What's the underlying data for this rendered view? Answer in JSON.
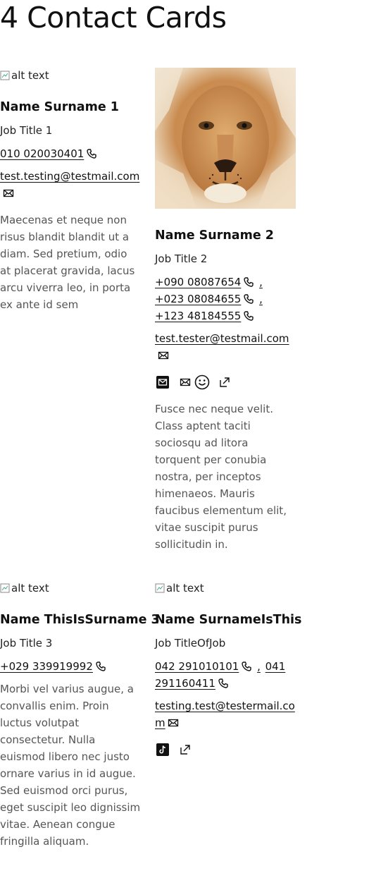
{
  "page": {
    "title": "4 Contact Cards"
  },
  "cards": [
    {
      "image_alt": "alt text",
      "name": "Name Surname 1",
      "job_title": "Job Title 1",
      "phones": [
        "010 020030401"
      ],
      "email": "test.testing@testmail.com",
      "description": "Maecenas et neque non risus blandit blandit ut a diam. Sed pretium, odio at placerat gravida, lacus arcu viverra leo, in porta ex ante id sem"
    },
    {
      "image_alt": "lion photo",
      "name": "Name Surname 2",
      "job_title": "Job Title 2",
      "phones": [
        "+090 08087654",
        "+023 08084655",
        "+123 48184555"
      ],
      "separator": ",",
      "email": "test.tester@testmail.com",
      "social_icons": [
        "mail-square-icon",
        "mail-icon",
        "smiley-icon",
        "external-link-icon"
      ],
      "description": "Fusce nec neque velit. Class aptent taciti sociosqu ad litora torquent per conubia nostra, per inceptos himenaeos. Mauris faucibus elementum elit, vitae suscipit purus sollicitudin in."
    },
    {
      "image_alt": "alt text",
      "name": "Name ThisIsSurname 3",
      "job_title": "Job Title 3",
      "phones": [
        "+029 339919992"
      ],
      "description": "Morbi vel varius augue, a convallis enim. Proin luctus volutpat consectetur. Nulla euismod libero nec justo ornare varius in id augue. Sed euismod orci purus, eget suscipit leo dignissim vitae. Aenean congue fringilla aliquam."
    },
    {
      "image_alt": "alt text",
      "name": "Name SurnameIsThis",
      "job_title": "Job TitleOfJob",
      "phones": [
        "042 291010101",
        "041 291160411"
      ],
      "separator": ",",
      "email": "testing.test@testermail.com",
      "social_icons": [
        "tiktok-icon",
        "external-link-icon"
      ]
    }
  ]
}
